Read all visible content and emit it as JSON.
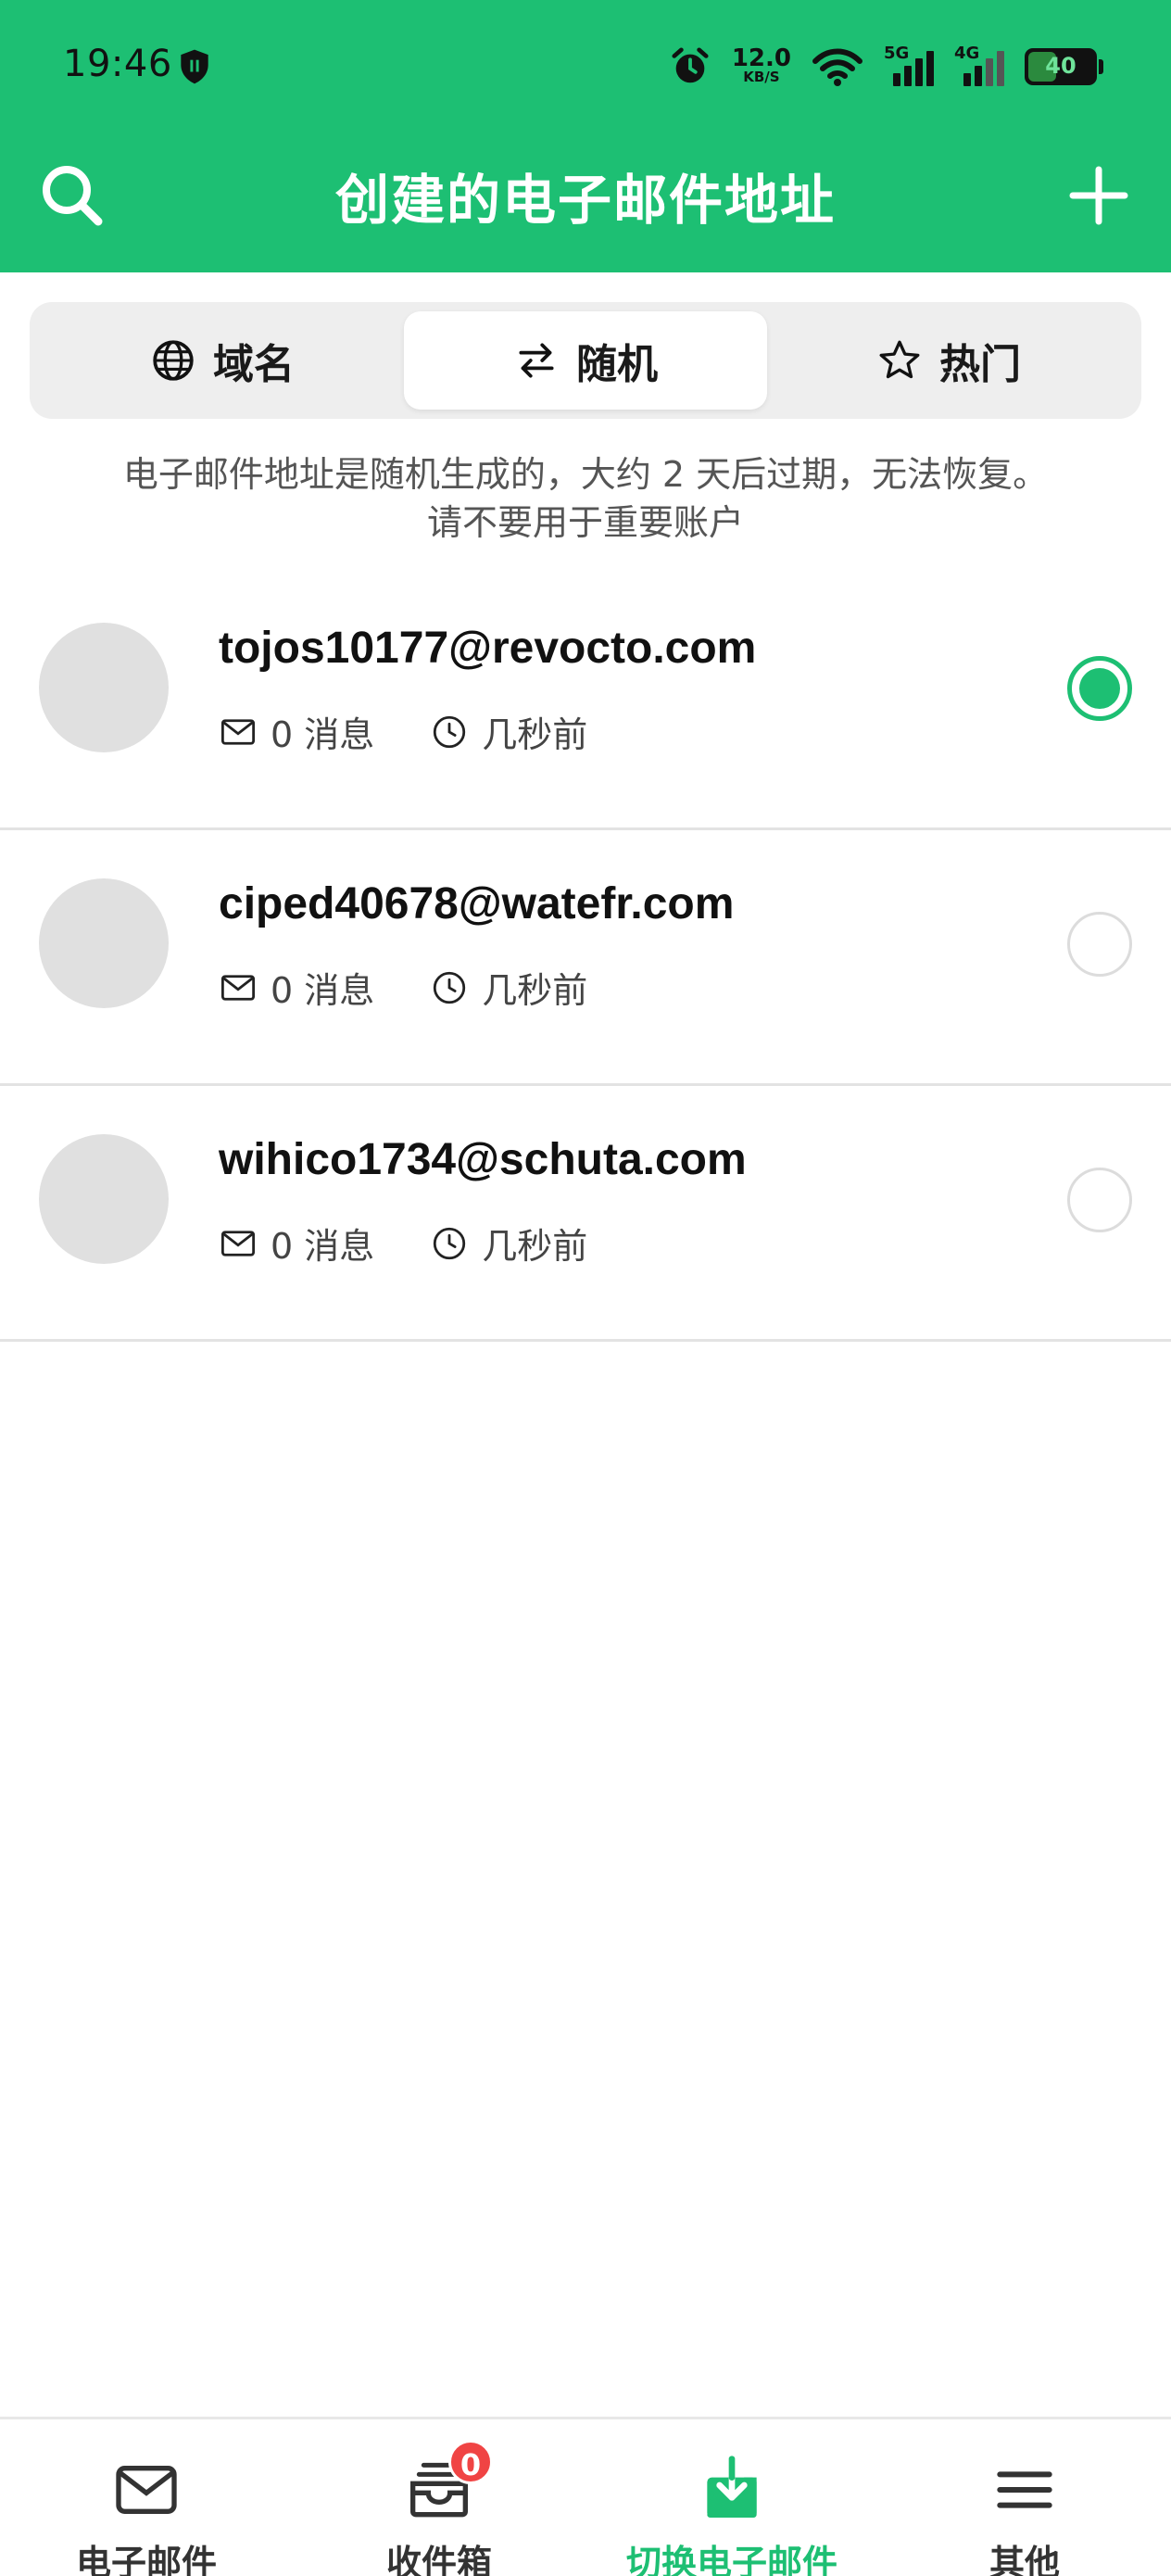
{
  "status_bar": {
    "time": "19:46",
    "net_speed": "12.0",
    "net_unit": "KB/S",
    "sim1_label": "5G",
    "sim2_label": "4G",
    "battery": "40"
  },
  "app_bar": {
    "title": "创建的电子邮件地址"
  },
  "tabs": [
    {
      "label": "域名",
      "icon": "globe-icon",
      "active": false
    },
    {
      "label": "随机",
      "icon": "swap-icon",
      "active": true
    },
    {
      "label": "热门",
      "icon": "star-icon",
      "active": false
    }
  ],
  "notice": {
    "line1": "电子邮件地址是随机生成的，大约 2 天后过期，无法恢复。",
    "line2": "请不要用于重要账户"
  },
  "emails": [
    {
      "address": "tojos10177@revocto.com",
      "messages": "0 消息",
      "time": "几秒前",
      "selected": true
    },
    {
      "address": "ciped40678@watefr.com",
      "messages": "0 消息",
      "time": "几秒前",
      "selected": false
    },
    {
      "address": "wihico1734@schuta.com",
      "messages": "0 消息",
      "time": "几秒前",
      "selected": false
    }
  ],
  "bottom_nav": {
    "items": [
      {
        "label": "电子邮件",
        "icon": "mail-icon"
      },
      {
        "label": "收件箱",
        "icon": "inbox-icon",
        "badge": "0"
      },
      {
        "label": "切换电子邮件",
        "icon": "download-icon",
        "active": true
      },
      {
        "label": "其他",
        "icon": "menu-icon"
      }
    ]
  },
  "colors": {
    "accent": "#1dbf73",
    "badge": "#f04444"
  }
}
